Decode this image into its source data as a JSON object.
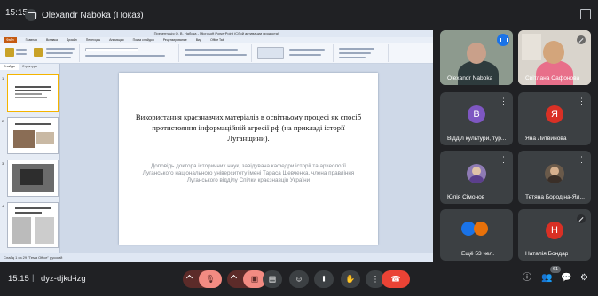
{
  "top": {
    "time": "15:15",
    "presenter": "Olexandr Naboka (Показ)"
  },
  "ppt": {
    "window_title": "Презентація О. В. Набока - Microsoft PowerPoint (Сбой активации продукта)",
    "tabs": [
      "Файл",
      "Главная",
      "Вставка",
      "Дизайн",
      "Переходы",
      "Анимация",
      "Показ слайдов",
      "Рецензирование",
      "Вид",
      "Office Tab"
    ],
    "panel_tabs": [
      "Слайды",
      "Структура"
    ],
    "slide_numbers": [
      "1",
      "2",
      "3",
      "4"
    ],
    "status": "Слайд 1 из 29    \"Тема Office\"    русский",
    "slide_title": "Використання краєзнавчих матеріалів в освітньому процесі як спосіб протистояння інформаційній агресії рф (на прикладі історії Луганщини).",
    "slide_subtitle": "Доповідь доктора історичних наук, завідувача кафедри історії та археології Луганського національного університету імені Тараса Шевченка, члена правління Луганського відділу Спілки краєзнавців України"
  },
  "participants": {
    "tile1_name": "Olexandr Naboka",
    "tile2_name": "Світлана Сафонова",
    "tile3_initial": "В",
    "tile3_name": "Відділ культури, тур...",
    "tile4_initial": "Я",
    "tile4_name": "Яна Литвинова",
    "tile5_name": "Юлія Сімонов",
    "tile6_name": "Тетяна Бородіна-Ял...",
    "tile7_name": "Ещё 53 чел.",
    "tile8_initial": "Н",
    "tile8_name": "Наталія Бондар"
  },
  "bottom": {
    "time": "15:15",
    "separator": "|",
    "meeting_code": "dyz-djkd-izg",
    "participant_count": "61"
  },
  "colors": {
    "bg": "#202124",
    "tile": "#3c4043",
    "red": "#ea4335",
    "blue": "#1a73e8",
    "avatar_purple": "#7e57c2",
    "avatar_red": "#d93025",
    "avatar_orange": "#e8710a"
  }
}
